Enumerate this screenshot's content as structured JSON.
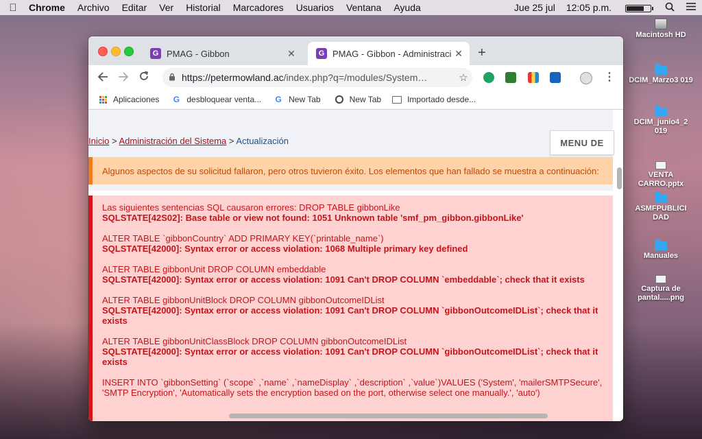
{
  "menubar": {
    "app": "Chrome",
    "items": [
      "Archivo",
      "Editar",
      "Ver",
      "Historial",
      "Marcadores",
      "Usuarios",
      "Ventana",
      "Ayuda"
    ],
    "date": "Jue 25 jul",
    "time": "12:05 p.m."
  },
  "desktop": [
    {
      "label": "Macintosh HD",
      "icon": "disk-icon"
    },
    {
      "label": "DCIM_Marzo3 019",
      "icon": "folder-icon"
    },
    {
      "label": "DCIM_junio4_2 019",
      "icon": "folder-icon"
    },
    {
      "label": "VENTA CARRO.pptx",
      "icon": "document-icon"
    },
    {
      "label": "ASMFPUBLICI DAD",
      "icon": "folder-icon"
    },
    {
      "label": "Manuales",
      "icon": "folder-icon"
    },
    {
      "label": "Captura de pantal.....png",
      "icon": "image-icon"
    }
  ],
  "browser": {
    "tabs": [
      {
        "title": "PMAG - Gibbon",
        "favicon": "G",
        "active": false
      },
      {
        "title": "PMAG - Gibbon - Administració",
        "favicon": "G",
        "active": true
      }
    ],
    "url_host": "https://petermowland.ac",
    "url_path": "/index.php?q=/modules/System…",
    "bookmarks": [
      "Aplicaciones",
      "desbloquear venta...",
      "New Tab",
      "New Tab",
      "Importado desde..."
    ]
  },
  "page": {
    "breadcrumb": {
      "home": "Inicio",
      "separator": ">",
      "section": "Administración del Sistema",
      "current": "Actualización"
    },
    "menu_button": "MENU DE",
    "warning": "Algunos aspectos de su solicitud fallaron, pero otros tuvieron éxito. Los elementos que han fallado se muestra a continuación:",
    "errors": [
      {
        "statement": "Las siguientes sentencias SQL causaron errores: DROP TABLE gibbonLike",
        "state": "SQLSTATE[42S02]: Base table or view not found: 1051 Unknown table 'smf_pm_gibbon.gibbonLike'"
      },
      {
        "statement": "ALTER TABLE `gibbonCountry` ADD PRIMARY KEY(`printable_name`)",
        "state": "SQLSTATE[42000]: Syntax error or access violation: 1068 Multiple primary key defined"
      },
      {
        "statement": "ALTER TABLE gibbonUnit DROP COLUMN embeddable",
        "state": "SQLSTATE[42000]: Syntax error or access violation: 1091 Can't DROP COLUMN `embeddable`; check that it exists"
      },
      {
        "statement": "ALTER TABLE gibbonUnitBlock DROP COLUMN gibbonOutcomeIDList",
        "state": "SQLSTATE[42000]: Syntax error or access violation: 1091 Can't DROP COLUMN `gibbonOutcomeIDList`; check that it exists"
      },
      {
        "statement": "ALTER TABLE gibbonUnitClassBlock DROP COLUMN gibbonOutcomeIDList",
        "state": "SQLSTATE[42000]: Syntax error or access violation: 1091 Can't DROP COLUMN `gibbonOutcomeIDList`; check that it exists"
      },
      {
        "statement": "INSERT INTO `gibbonSetting` (`scope` ,`name` ,`nameDisplay` ,`description` ,`value`)VALUES ('System', 'mailerSMTPSecure', 'SMTP Encryption', 'Automatically sets the encryption based on the port, otherwise select one manually.', 'auto')",
        "state": ""
      }
    ]
  },
  "colors": {
    "warning_bg": "#ffd2a8",
    "warning_border": "#f07b1d",
    "error_bg": "#ffd2d2",
    "error_border": "#d6151a",
    "error_text": "#c4141a",
    "link": "#a0131b"
  }
}
